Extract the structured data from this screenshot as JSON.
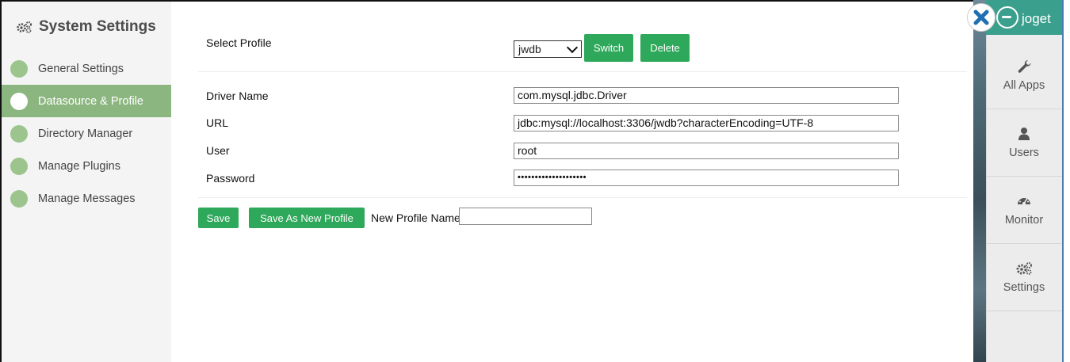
{
  "sidebar": {
    "title": "System Settings",
    "items": [
      {
        "label": "General Settings",
        "active": false
      },
      {
        "label": "Datasource & Profile",
        "active": true
      },
      {
        "label": "Directory Manager",
        "active": false
      },
      {
        "label": "Manage Plugins",
        "active": false
      },
      {
        "label": "Manage Messages",
        "active": false
      }
    ]
  },
  "profile": {
    "label": "Select Profile",
    "selected": "jwdb",
    "switch_label": "Switch",
    "delete_label": "Delete"
  },
  "fields": {
    "driver": {
      "label": "Driver Name",
      "value": "com.mysql.jdbc.Driver"
    },
    "url": {
      "label": "URL",
      "value": "jdbc:mysql://localhost:3306/jwdb?characterEncoding=UTF-8"
    },
    "user": {
      "label": "User",
      "value": "root"
    },
    "password": {
      "label": "Password",
      "value": "••••••••••••••••••••"
    }
  },
  "actions": {
    "save_label": "Save",
    "save_new_label": "Save As New Profile",
    "new_profile_label": "New Profile Name",
    "new_profile_value": ""
  },
  "dock": {
    "brand": "joget",
    "items": [
      {
        "label": "All Apps",
        "icon": "wrench-icon"
      },
      {
        "label": "Users",
        "icon": "user-icon"
      },
      {
        "label": "Monitor",
        "icon": "dashboard-icon"
      },
      {
        "label": "Settings",
        "icon": "gears-icon"
      }
    ]
  },
  "colors": {
    "accent": "#2ea85a",
    "sidebar_active": "#8cb680",
    "dot": "#9cc48d",
    "brand": "#3b9f8e",
    "close": "#1f6fb2"
  }
}
